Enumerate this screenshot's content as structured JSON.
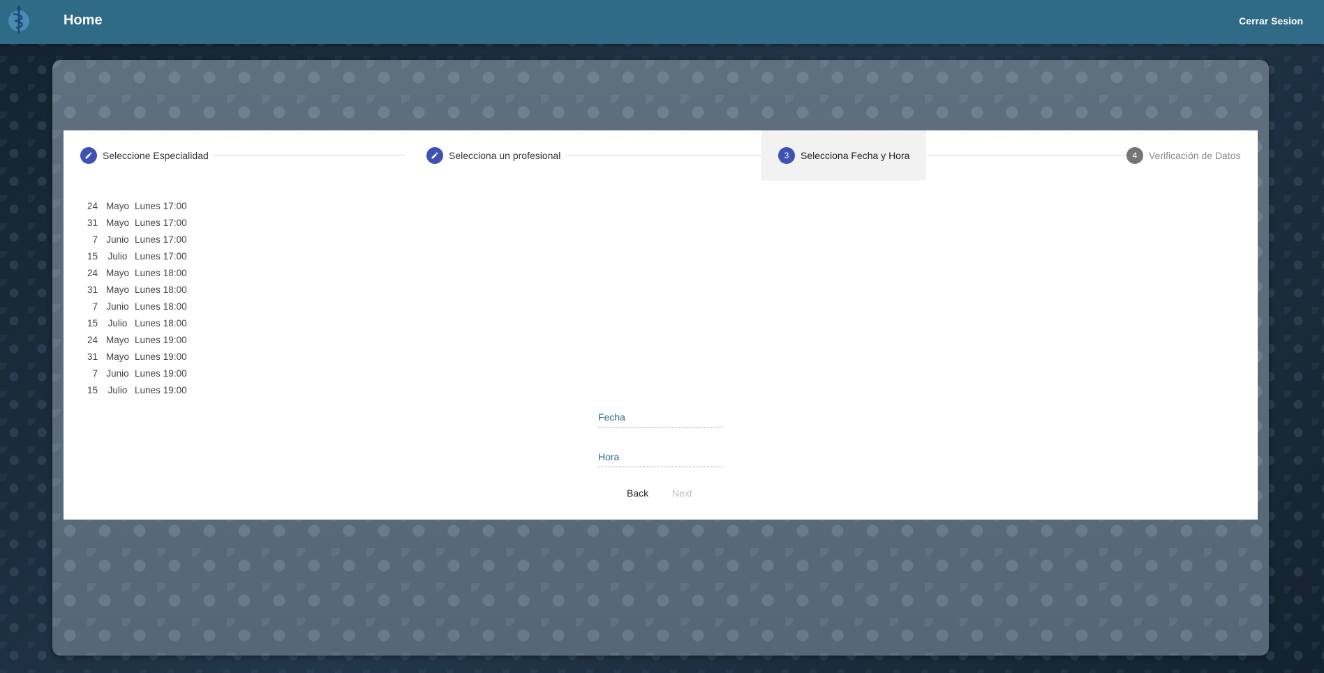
{
  "header": {
    "title": "Home",
    "logout_label": "Cerrar Sesion",
    "logo_icon": "medical-caduceus-icon",
    "color": "#2f6a86"
  },
  "stepper": {
    "steps": [
      {
        "number": "1",
        "label": "Seleccione Especialidad",
        "state": "completed",
        "icon": "pencil-icon"
      },
      {
        "number": "2",
        "label": "Selecciona un profesional",
        "state": "completed",
        "icon": "pencil-icon"
      },
      {
        "number": "3",
        "label": "Selecciona Fecha y Hora",
        "state": "active"
      },
      {
        "number": "4",
        "label": "Verificación de Datos",
        "state": "inactive"
      }
    ],
    "accent": "#3f51b5"
  },
  "slots": [
    {
      "day": "24",
      "month": "Mayo",
      "weekday": "Lunes",
      "time": "17:00"
    },
    {
      "day": "31",
      "month": "Mayo",
      "weekday": "Lunes",
      "time": "17:00"
    },
    {
      "day": "7",
      "month": "Junio",
      "weekday": "Lunes",
      "time": "17:00"
    },
    {
      "day": "15",
      "month": "Julio",
      "weekday": "Lunes",
      "time": "17:00"
    },
    {
      "day": "24",
      "month": "Mayo",
      "weekday": "Lunes",
      "time": "18:00"
    },
    {
      "day": "31",
      "month": "Mayo",
      "weekday": "Lunes",
      "time": "18:00"
    },
    {
      "day": "7",
      "month": "Junio",
      "weekday": "Lunes",
      "time": "18:00"
    },
    {
      "day": "15",
      "month": "Julio",
      "weekday": "Lunes",
      "time": "18:00"
    },
    {
      "day": "24",
      "month": "Mayo",
      "weekday": "Lunes",
      "time": "19:00"
    },
    {
      "day": "31",
      "month": "Mayo",
      "weekday": "Lunes",
      "time": "19:00"
    },
    {
      "day": "7",
      "month": "Junio",
      "weekday": "Lunes",
      "time": "19:00"
    },
    {
      "day": "15",
      "month": "Julio",
      "weekday": "Lunes",
      "time": "19:00"
    }
  ],
  "form": {
    "fecha_placeholder": "Fecha",
    "fecha_value": "",
    "hora_placeholder": "Hora",
    "hora_value": ""
  },
  "actions": {
    "back_label": "Back",
    "next_label": "Next"
  }
}
